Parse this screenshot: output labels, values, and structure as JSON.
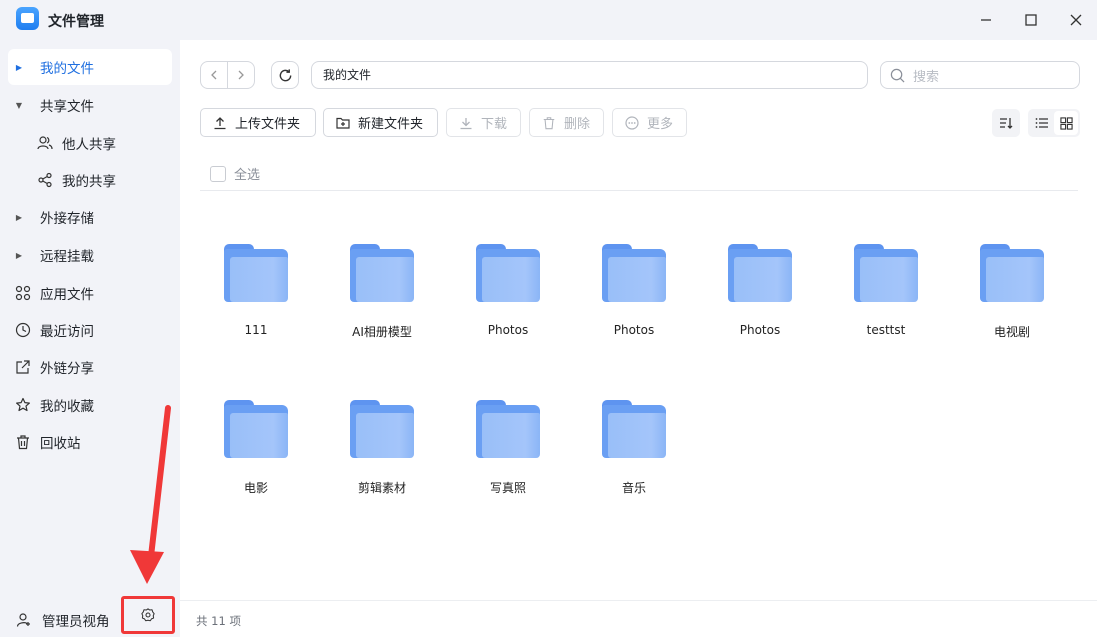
{
  "window": {
    "title": "文件管理",
    "controls": [
      "minimize-icon",
      "maximize-icon",
      "close-icon"
    ]
  },
  "sidebar": {
    "items": [
      {
        "label": "我的文件",
        "icon": "caret-right-icon",
        "active": true
      },
      {
        "label": "共享文件",
        "icon": "caret-down-icon"
      },
      {
        "label": "他人共享",
        "icon": "users-icon",
        "child": true
      },
      {
        "label": "我的共享",
        "icon": "share-icon",
        "child": true
      },
      {
        "label": "外接存储",
        "icon": "caret-right-icon"
      },
      {
        "label": "远程挂载",
        "icon": "caret-right-icon"
      },
      {
        "label": "应用文件",
        "icon": "apps-icon"
      },
      {
        "label": "最近访问",
        "icon": "clock-icon"
      },
      {
        "label": "外链分享",
        "icon": "external-link-icon"
      },
      {
        "label": "我的收藏",
        "icon": "star-icon"
      },
      {
        "label": "回收站",
        "icon": "trash-icon"
      }
    ],
    "admin_label": "管理员视角"
  },
  "toolbar": {
    "path": "我的文件",
    "search_placeholder": "搜索",
    "upload_label": "上传文件夹",
    "new_folder_label": "新建文件夹",
    "download_label": "下载",
    "delete_label": "删除",
    "more_label": "更多"
  },
  "select_all_label": "全选",
  "files": [
    {
      "name": "111"
    },
    {
      "name": "AI相册模型"
    },
    {
      "name": "Photos"
    },
    {
      "name": "Photos"
    },
    {
      "name": "Photos"
    },
    {
      "name": "testtst"
    },
    {
      "name": "电视剧"
    },
    {
      "name": "电影"
    },
    {
      "name": "剪辑素材"
    },
    {
      "name": "写真照"
    },
    {
      "name": "音乐"
    }
  ],
  "status": {
    "count_text": "共 11 项"
  },
  "colors": {
    "accent": "#1f6fe0",
    "annotation": "#f03838",
    "folder": "#6a9ff3"
  }
}
